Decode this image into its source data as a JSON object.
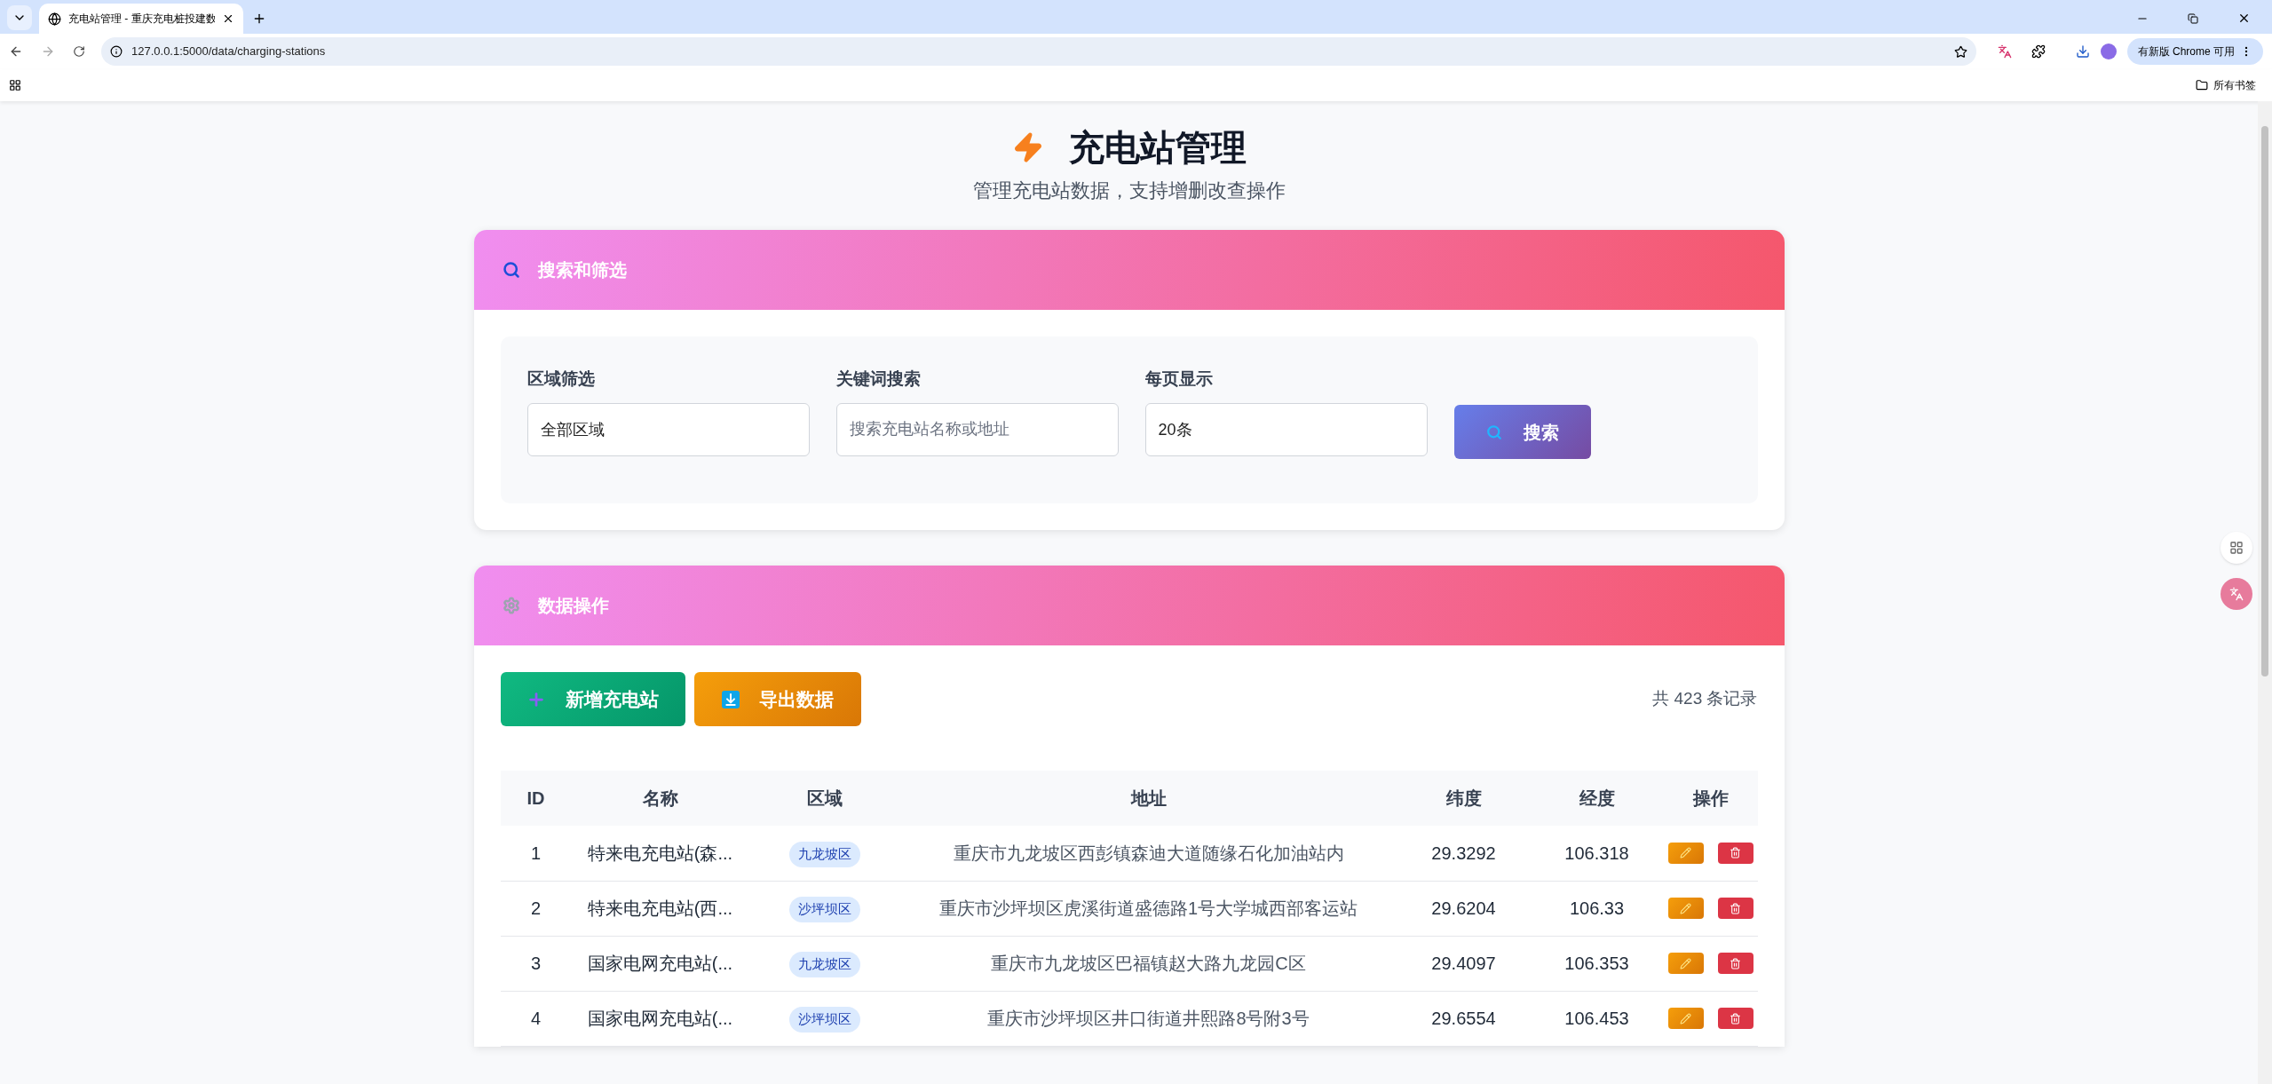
{
  "browser": {
    "tab_title": "充电站管理 - 重庆充电桩投建数",
    "url": "127.0.0.1:5000/data/charging-stations",
    "update_button": "有新版 Chrome 可用",
    "bookmarks_label": "所有书签"
  },
  "header": {
    "title": "充电站管理",
    "subtitle": "管理充电站数据，支持增删改查操作"
  },
  "search_card": {
    "title": "搜索和筛选",
    "fields": [
      {
        "label": "区域筛选",
        "value": "全部区域"
      },
      {
        "label": "关键词搜索",
        "placeholder": "搜索充电站名称或地址"
      },
      {
        "label": "每页显示",
        "value": "20条"
      }
    ],
    "button": "搜索"
  },
  "data_card": {
    "title": "数据操作",
    "add_button": "新增充电站",
    "export_button": "导出数据",
    "record_count": "共 423 条记录",
    "table": {
      "columns": [
        "ID",
        "名称",
        "区域",
        "地址",
        "纬度",
        "经度",
        "操作"
      ],
      "rows": [
        {
          "id": "1",
          "name": "特来电充电站(森...",
          "district": "九龙坡区",
          "address": "重庆市九龙坡区西彭镇森迪大道随缘石化加油站内",
          "lat": "29.3292",
          "lng": "106.318"
        },
        {
          "id": "2",
          "name": "特来电充电站(西...",
          "district": "沙坪坝区",
          "address": "重庆市沙坪坝区虎溪街道盛德路1号大学城西部客运站",
          "lat": "29.6204",
          "lng": "106.33"
        },
        {
          "id": "3",
          "name": "国家电网充电站(...",
          "district": "九龙坡区",
          "address": "重庆市九龙坡区巴福镇赵大路九龙园C区",
          "lat": "29.4097",
          "lng": "106.353"
        },
        {
          "id": "4",
          "name": "国家电网充电站(...",
          "district": "沙坪坝区",
          "address": "重庆市沙坪坝区井口街道井熙路8号附3号",
          "lat": "29.6554",
          "lng": "106.453"
        }
      ]
    }
  }
}
